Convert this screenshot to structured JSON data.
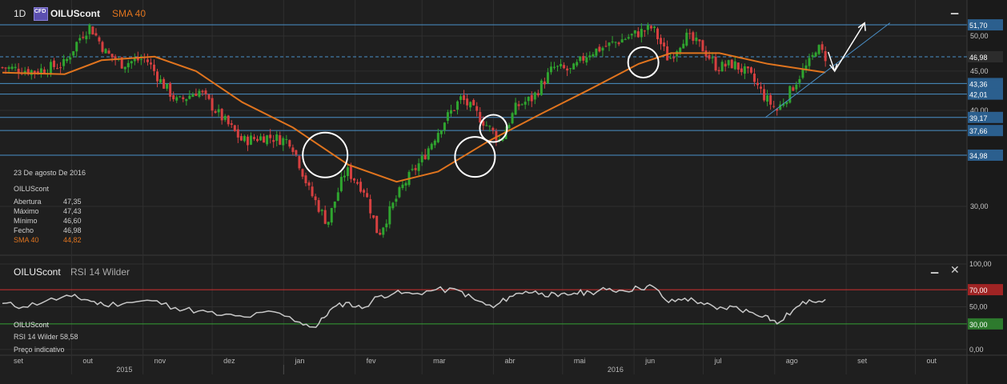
{
  "header": {
    "timeframe": "1D",
    "badge": "CFD",
    "symbol": "OILUScont",
    "indicator": "SMA 40"
  },
  "info_panel": {
    "date": "23 De agosto De 2016",
    "symbol": "OILUScont",
    "rows": [
      {
        "label": "Abertura",
        "value": "47,35"
      },
      {
        "label": "Máximo",
        "value": "47,43"
      },
      {
        "label": "Mínimo",
        "value": "46,60"
      },
      {
        "label": "Fecho",
        "value": "46,98"
      },
      {
        "label": "SMA 40",
        "value": "44,82"
      }
    ]
  },
  "rsi_header": {
    "symbol": "OILUScont",
    "indicator": "RSI 14 Wilder"
  },
  "rsi_info": {
    "symbol": "OILUScont",
    "line": "RSI 14 Wilder 58,58",
    "note": "Preço indicativo"
  },
  "colors": {
    "background": "#1f1f1f",
    "grid": "#2f2f2f",
    "up_candle": "#2fa52f",
    "down_candle": "#d64040",
    "sma": "#e0741e",
    "levels": "#4a90c8",
    "rsi_line": "#c8c8c8",
    "rsi_upper": "#d03030",
    "rsi_lower": "#35a035",
    "annotation": "#ffffff"
  },
  "icons": {
    "minimize": "minimize-icon",
    "close": "close-icon"
  },
  "chart_data": [
    {
      "type": "candlestick",
      "title": "OILUScont 1D",
      "y_scale": "log",
      "y_ticks": [
        "50,00",
        "45,00",
        "40,00",
        "30,00"
      ],
      "x_months": [
        "set",
        "out",
        "nov",
        "dez",
        "jan",
        "fev",
        "mar",
        "abr",
        "mai",
        "jun",
        "jul",
        "ago",
        "set",
        "out"
      ],
      "x_years": [
        "2015",
        "2016"
      ],
      "close_path": [
        [
          "2015-09-01",
          45.5
        ],
        [
          "2015-09-15",
          45.0
        ],
        [
          "2015-09-28",
          46.0
        ],
        [
          "2015-10-05",
          50.0
        ],
        [
          "2015-10-09",
          51.5
        ],
        [
          "2015-10-16",
          47.5
        ],
        [
          "2015-10-23",
          46.0
        ],
        [
          "2015-11-02",
          46.8
        ],
        [
          "2015-11-09",
          43.5
        ],
        [
          "2015-11-16",
          41.0
        ],
        [
          "2015-11-25",
          42.5
        ],
        [
          "2015-12-04",
          39.5
        ],
        [
          "2015-12-14",
          36.5
        ],
        [
          "2015-12-24",
          37.0
        ],
        [
          "2016-01-04",
          36.5
        ],
        [
          "2016-01-12",
          31.5
        ],
        [
          "2016-01-20",
          28.5
        ],
        [
          "2016-01-28",
          33.5
        ],
        [
          "2016-02-05",
          31.5
        ],
        [
          "2016-02-11",
          27.5
        ],
        [
          "2016-02-22",
          32.0
        ],
        [
          "2016-03-01",
          34.5
        ],
        [
          "2016-03-10",
          38.5
        ],
        [
          "2016-03-18",
          41.5
        ],
        [
          "2016-03-25",
          39.5
        ],
        [
          "2016-04-04",
          36.5
        ],
        [
          "2016-04-11",
          40.5
        ],
        [
          "2016-04-18",
          41.5
        ],
        [
          "2016-04-27",
          45.5
        ],
        [
          "2016-05-05",
          45.0
        ],
        [
          "2016-05-12",
          47.5
        ],
        [
          "2016-05-20",
          48.5
        ],
        [
          "2016-05-27",
          49.5
        ],
        [
          "2016-06-03",
          50.5
        ],
        [
          "2016-06-09",
          51.3
        ],
        [
          "2016-06-16",
          46.5
        ],
        [
          "2016-06-23",
          50.0
        ],
        [
          "2016-06-30",
          48.5
        ],
        [
          "2016-07-07",
          45.5
        ],
        [
          "2016-07-14",
          46.0
        ],
        [
          "2016-07-21",
          44.5
        ],
        [
          "2016-07-28",
          41.5
        ],
        [
          "2016-08-02",
          40.0
        ],
        [
          "2016-08-08",
          42.5
        ],
        [
          "2016-08-12",
          44.5
        ],
        [
          "2016-08-17",
          46.5
        ],
        [
          "2016-08-19",
          48.5
        ],
        [
          "2016-08-23",
          46.98
        ]
      ],
      "sma40_path": [
        [
          "2015-09-01",
          44.8
        ],
        [
          "2015-09-28",
          44.6
        ],
        [
          "2015-10-14",
          46.5
        ],
        [
          "2015-11-06",
          47.0
        ],
        [
          "2015-11-24",
          45.0
        ],
        [
          "2015-12-14",
          41.0
        ],
        [
          "2016-01-05",
          38.0
        ],
        [
          "2016-01-29",
          34.0
        ],
        [
          "2016-02-19",
          32.3
        ],
        [
          "2016-03-08",
          33.3
        ],
        [
          "2016-03-30",
          36.5
        ],
        [
          "2016-04-21",
          39.5
        ],
        [
          "2016-05-12",
          42.5
        ],
        [
          "2016-06-03",
          46.0
        ],
        [
          "2016-06-17",
          47.5
        ],
        [
          "2016-07-08",
          47.5
        ],
        [
          "2016-07-29",
          46.0
        ],
        [
          "2016-08-23",
          44.82
        ]
      ],
      "levels": [
        {
          "value": 51.7,
          "label": "51,70",
          "style": "solid"
        },
        {
          "value": 46.98,
          "label": "46,98",
          "style": "dashed"
        },
        {
          "value": 43.36,
          "label": "43,36",
          "style": "solid"
        },
        {
          "value": 42.01,
          "label": "42,01",
          "style": "solid"
        },
        {
          "value": 39.17,
          "label": "39,17",
          "style": "solid"
        },
        {
          "value": 37.66,
          "label": "37,66",
          "style": "solid"
        },
        {
          "value": 34.98,
          "label": "34,98",
          "style": "solid"
        }
      ],
      "trendline": [
        [
          "2016-07-28",
          39.17
        ],
        [
          "2016-09-20",
          52.0
        ]
      ],
      "annotation_arrow": [
        [
          "2016-08-27",
          45.0
        ],
        [
          "2016-09-09",
          52.0
        ]
      ],
      "highlight_circles": [
        [
          "2016-01-19",
          35.0
        ],
        [
          "2016-03-24",
          34.8
        ],
        [
          "2016-04-01",
          37.9
        ],
        [
          "2016-06-05",
          46.2
        ]
      ]
    },
    {
      "type": "line",
      "title": "RSI 14 Wilder",
      "y_ticks": [
        "100,00",
        "70,00",
        "50,00",
        "30,00",
        "0,00"
      ],
      "ylim": [
        0,
        100
      ],
      "upper": 70,
      "lower": 30,
      "x": [
        "2015-09-01",
        "2015-09-10",
        "2015-09-20",
        "2015-10-01",
        "2015-10-08",
        "2015-10-15",
        "2015-10-25",
        "2015-11-05",
        "2015-11-15",
        "2015-11-25",
        "2015-12-05",
        "2015-12-15",
        "2015-12-28",
        "2016-01-08",
        "2016-01-15",
        "2016-01-21",
        "2016-01-28",
        "2016-02-04",
        "2016-02-11",
        "2016-02-18",
        "2016-02-26",
        "2016-03-07",
        "2016-03-17",
        "2016-03-24",
        "2016-04-01",
        "2016-04-08",
        "2016-04-15",
        "2016-04-22",
        "2016-04-29",
        "2016-05-06",
        "2016-05-13",
        "2016-05-20",
        "2016-05-27",
        "2016-06-03",
        "2016-06-09",
        "2016-06-16",
        "2016-06-23",
        "2016-06-30",
        "2016-07-07",
        "2016-07-14",
        "2016-07-21",
        "2016-07-28",
        "2016-08-02",
        "2016-08-09",
        "2016-08-16",
        "2016-08-23"
      ],
      "values": [
        54,
        50,
        57,
        62,
        58,
        52,
        55,
        57,
        49,
        45,
        40,
        38,
        44,
        32,
        26,
        46,
        55,
        48,
        62,
        66,
        65,
        70,
        69,
        58,
        49,
        62,
        68,
        66,
        62,
        66,
        67,
        70,
        69,
        72,
        74,
        55,
        60,
        55,
        47,
        50,
        44,
        40,
        30,
        46,
        58,
        58.58
      ]
    }
  ]
}
